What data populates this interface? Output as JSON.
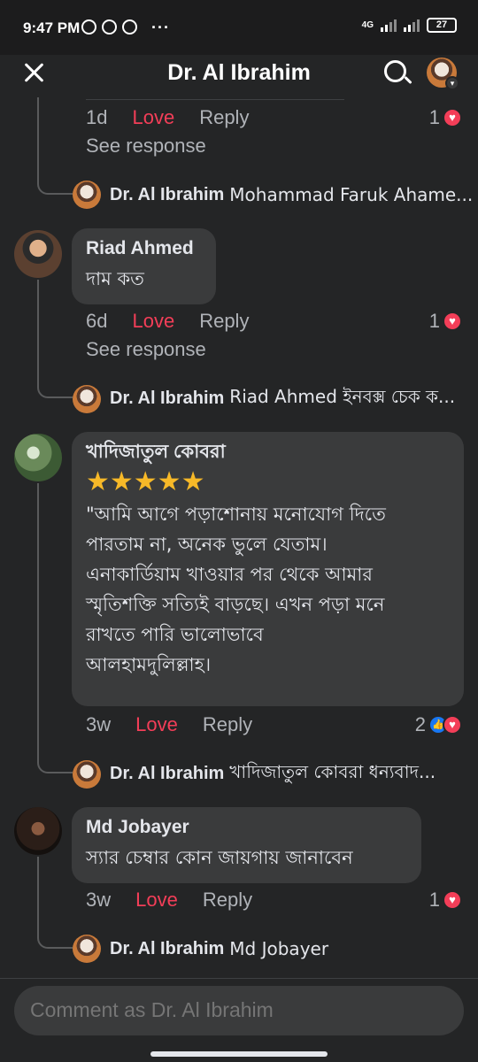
{
  "status_bar": {
    "time": "9:47 PM",
    "network": "4G",
    "battery": "27"
  },
  "header": {
    "title": "Dr. Al Ibrahim"
  },
  "thread": {
    "first_comment_tail": {
      "time": "1d",
      "love": "Love",
      "reply": "Reply",
      "reaction_count": "1",
      "see_response": "See response",
      "reply_author": "Dr. Al Ibrahim",
      "reply_snippet": "Mohammad Faruk Ahame..."
    },
    "comments": [
      {
        "author": "Riad Ahmed",
        "text": "দাম কত",
        "time": "6d",
        "love": "Love",
        "reply": "Reply",
        "reaction_count": "1",
        "see_response": "See response",
        "reply_author": "Dr. Al Ibrahim",
        "reply_snippet": "Riad Ahmed ইনবক্স চেক ক..."
      },
      {
        "author": "খাদিজাতুল কোবরা",
        "stars": "★★★★★",
        "text_lines": [
          "\"আমি আগে পড়াশোনায় মনোযোগ দিতে",
          "পারতাম না, অনেক ভুলে যেতাম।",
          "এনাকার্ডিয়াম খাওয়ার পর থেকে আমার",
          "স্মৃতিশক্তি সত্যিই বাড়ছে। এখন পড়া মনে",
          "রাখতে পারি ভালোভাবে",
          "আলহামদুলিল্লাহ।"
        ],
        "time": "3w",
        "love": "Love",
        "reply": "Reply",
        "reaction_count": "2",
        "reply_author": "Dr. Al Ibrahim",
        "reply_snippet": "খাদিজাতুল কোবরা ধন্যবাদ..."
      },
      {
        "author": "Md Jobayer",
        "text": "স্যার চেম্বার কোন জায়গায় জানাবেন",
        "time": "3w",
        "love": "Love",
        "reply": "Reply",
        "reaction_count": "1",
        "reply_author": "Dr. Al Ibrahim",
        "reply_snippet": "Md Jobayer"
      }
    ]
  },
  "composer": {
    "placeholder": "Comment as Dr. Al Ibrahim"
  },
  "colors": {
    "background": "#242526",
    "bubble": "#3a3b3c",
    "love": "#f33e58",
    "like": "#1877f2",
    "star": "#f7b928"
  }
}
